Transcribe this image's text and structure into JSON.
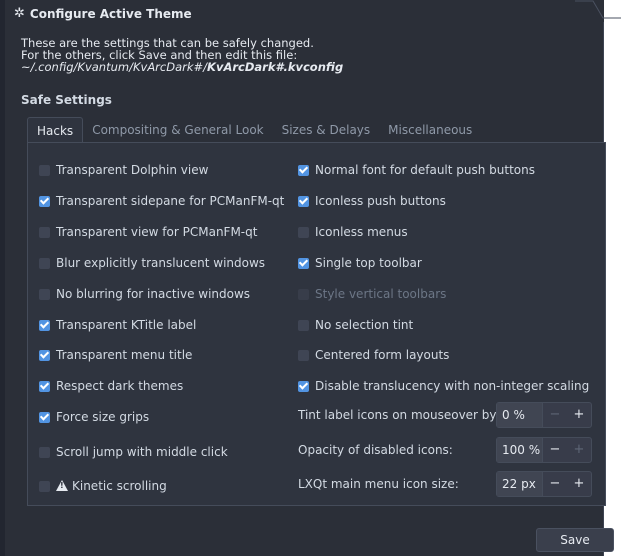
{
  "group": {
    "title": "Configure Active Theme",
    "icon": "configure-icon"
  },
  "intro": {
    "line1": "These are the settings that can be safely changed.",
    "line2": "For the others, click Save and then edit this file:",
    "path_prefix": "~/.config/Kvantum/KvArcDark#/",
    "path_file": "KvArcDark#.kvconfig"
  },
  "section_title": "Safe Settings",
  "tabs": [
    {
      "label": "Hacks",
      "active": true
    },
    {
      "label": "Compositing & General Look",
      "active": false
    },
    {
      "label": "Sizes & Delays",
      "active": false
    },
    {
      "label": "Miscellaneous",
      "active": false
    }
  ],
  "left_options": [
    {
      "label": "Transparent Dolphin view",
      "checked": false
    },
    {
      "label": "Transparent sidepane for PCManFM-qt",
      "checked": true
    },
    {
      "label": "Transparent view for PCManFM-qt",
      "checked": false
    },
    {
      "label": "Blur explicitly translucent windows",
      "checked": false
    },
    {
      "label": "No blurring for inactive windows",
      "checked": false
    },
    {
      "label": "Transparent KTitle label",
      "checked": true
    },
    {
      "label": "Transparent menu title",
      "checked": true
    },
    {
      "label": "Respect dark themes",
      "checked": true
    },
    {
      "label": "Force size grips",
      "checked": true
    },
    {
      "label": "Scroll jump with middle click",
      "checked": false
    },
    {
      "label": "Kinetic scrolling",
      "checked": false,
      "icon": "warning-icon"
    }
  ],
  "right_options": [
    {
      "label": "Normal font for default push buttons",
      "checked": true
    },
    {
      "label": "Iconless push buttons",
      "checked": true
    },
    {
      "label": "Iconless menus",
      "checked": false
    },
    {
      "label": "Single top toolbar",
      "checked": true
    },
    {
      "label": "Style vertical toolbars",
      "checked": false,
      "disabled": true
    },
    {
      "label": "No selection tint",
      "checked": false
    },
    {
      "label": "Centered form layouts",
      "checked": false
    },
    {
      "label": "Disable translucency with non-integer scaling",
      "checked": true
    }
  ],
  "spinboxes": [
    {
      "label": "Tint label icons on mouseover by",
      "value": "0 %",
      "minus_enabled": false,
      "plus_enabled": true
    },
    {
      "label": "Opacity of disabled icons:",
      "value": "100 %",
      "minus_enabled": true,
      "plus_enabled": false
    },
    {
      "label": "LXQt main menu icon size:",
      "value": "22 px",
      "minus_enabled": true,
      "plus_enabled": true
    }
  ],
  "spin_symbols": {
    "minus": "−",
    "plus": "+"
  },
  "save_label": "Save",
  "colors": {
    "accent": "#5294e2",
    "background": "#2b2f38",
    "panel": "#2f343f",
    "text": "#d3dae3"
  }
}
